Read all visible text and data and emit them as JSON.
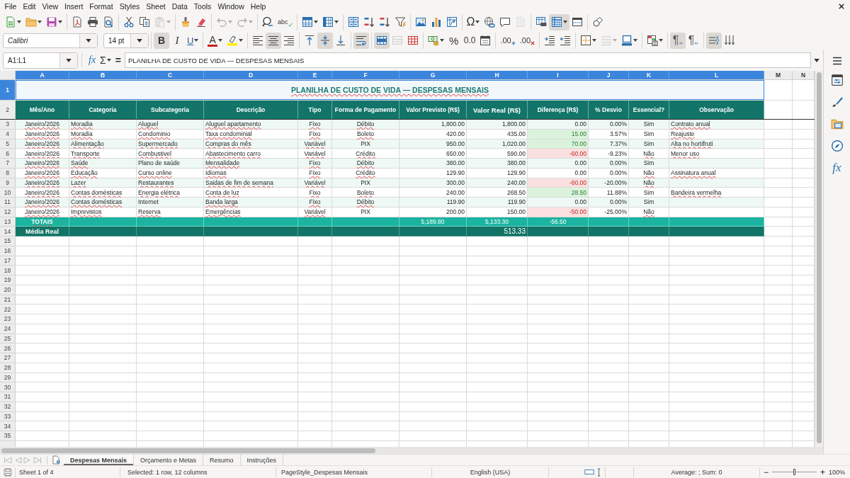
{
  "menu_bar": [
    "File",
    "Edit",
    "View",
    "Insert",
    "Format",
    "Styles",
    "Sheet",
    "Data",
    "Tools",
    "Window",
    "Help"
  ],
  "standard_toolbar": [
    [
      {
        "kind": "new",
        "on": false,
        "disabled": false,
        "dropdown": true
      },
      {
        "kind": "open",
        "on": false,
        "disabled": false,
        "dropdown": true
      },
      {
        "kind": "save",
        "on": false,
        "disabled": false,
        "dropdown": true
      }
    ],
    [
      {
        "kind": "export_pdf",
        "on": false,
        "disabled": false,
        "dropdown": false
      },
      {
        "kind": "print",
        "on": false,
        "disabled": false,
        "dropdown": false
      },
      {
        "kind": "print_preview",
        "on": false,
        "disabled": false,
        "dropdown": false
      }
    ],
    [
      {
        "kind": "cut",
        "on": false,
        "disabled": false,
        "dropdown": false
      },
      {
        "kind": "copy",
        "on": false,
        "disabled": false,
        "dropdown": false
      },
      {
        "kind": "paste",
        "on": false,
        "disabled": true,
        "dropdown": true
      }
    ],
    [
      {
        "kind": "clone_formatting",
        "on": false,
        "disabled": false,
        "dropdown": false
      },
      {
        "kind": "clear_formatting",
        "on": false,
        "disabled": false,
        "dropdown": false
      }
    ],
    [
      {
        "kind": "undo",
        "on": false,
        "disabled": true,
        "dropdown": true
      },
      {
        "kind": "redo",
        "on": false,
        "disabled": true,
        "dropdown": true
      }
    ],
    [
      {
        "kind": "find_replace",
        "on": false,
        "disabled": false,
        "dropdown": false
      },
      {
        "kind": "spelling",
        "label": "abc",
        "on": false,
        "disabled": false,
        "dropdown": false
      }
    ],
    [
      {
        "kind": "rows",
        "on": false,
        "disabled": false,
        "dropdown": true
      },
      {
        "kind": "columns",
        "on": false,
        "disabled": false,
        "dropdown": true
      }
    ],
    [
      {
        "kind": "sort",
        "on": false,
        "disabled": false,
        "dropdown": false
      },
      {
        "kind": "sort_ascending",
        "on": false,
        "disabled": false,
        "dropdown": false
      },
      {
        "kind": "sort_descending",
        "on": false,
        "disabled": false,
        "dropdown": false
      },
      {
        "kind": "autofilter",
        "on": false,
        "disabled": false,
        "dropdown": false
      }
    ],
    [
      {
        "kind": "image",
        "on": false,
        "disabled": false,
        "dropdown": false
      },
      {
        "kind": "chart",
        "on": false,
        "disabled": false,
        "dropdown": false
      },
      {
        "kind": "pivot_table",
        "on": false,
        "disabled": false,
        "dropdown": false
      }
    ],
    [
      {
        "kind": "special_character",
        "label": "Ω",
        "on": false,
        "disabled": false,
        "dropdown": true
      },
      {
        "kind": "hyperlink",
        "on": false,
        "disabled": false,
        "dropdown": false
      },
      {
        "kind": "comment",
        "on": false,
        "disabled": false,
        "dropdown": false
      },
      {
        "kind": "headers_footers",
        "on": false,
        "disabled": true,
        "dropdown": false
      }
    ],
    [
      {
        "kind": "print_area",
        "on": false,
        "disabled": false,
        "dropdown": false
      },
      {
        "kind": "freeze",
        "on": true,
        "disabled": false,
        "dropdown": true
      },
      {
        "kind": "split_window",
        "on": false,
        "disabled": false,
        "dropdown": false
      }
    ],
    [
      {
        "kind": "draw_functions",
        "on": false,
        "disabled": false,
        "dropdown": false
      }
    ]
  ],
  "formatting_toolbar": {
    "font_name": "Calibri",
    "font_size": "14 pt",
    "groups": [
      [
        {
          "kind": "bold",
          "label": "B",
          "on": true,
          "disabled": false,
          "dropdown": false
        },
        {
          "kind": "italic",
          "label": "I",
          "on": false,
          "disabled": false,
          "dropdown": false
        },
        {
          "kind": "underline",
          "label": "U",
          "on": false,
          "disabled": false,
          "dropdown": true
        }
      ],
      [
        {
          "kind": "font_color",
          "label": "A",
          "on": false,
          "disabled": false,
          "dropdown": true
        },
        {
          "kind": "highlight",
          "on": false,
          "disabled": false,
          "dropdown": true
        }
      ],
      [
        {
          "kind": "align_left",
          "on": false,
          "disabled": false,
          "dropdown": false
        },
        {
          "kind": "align_center",
          "on": true,
          "disabled": false,
          "dropdown": false
        },
        {
          "kind": "align_right",
          "on": false,
          "disabled": false,
          "dropdown": false
        }
      ],
      [
        {
          "kind": "align_top",
          "on": false,
          "disabled": false,
          "dropdown": false
        },
        {
          "kind": "align_middle",
          "on": true,
          "disabled": false,
          "dropdown": false
        },
        {
          "kind": "align_bottom",
          "on": false,
          "disabled": false,
          "dropdown": false
        }
      ],
      [
        {
          "kind": "wrap_text",
          "on": true,
          "disabled": false,
          "dropdown": false
        }
      ],
      [
        {
          "kind": "merge_center",
          "on": true,
          "disabled": false,
          "dropdown": false
        },
        {
          "kind": "merge_cells",
          "on": false,
          "disabled": true,
          "dropdown": false
        },
        {
          "kind": "unmerge_cells",
          "on": false,
          "disabled": false,
          "dropdown": false
        }
      ],
      [
        {
          "kind": "currency_format",
          "on": false,
          "disabled": false,
          "dropdown": true
        },
        {
          "kind": "percent_format",
          "label": "%",
          "on": false,
          "disabled": false,
          "dropdown": false
        },
        {
          "kind": "number_format",
          "label": "0.0",
          "on": false,
          "disabled": false,
          "dropdown": false
        },
        {
          "kind": "date_format",
          "on": false,
          "disabled": false,
          "dropdown": false
        }
      ],
      [
        {
          "kind": "add_decimal",
          "label": ".00",
          "on": false,
          "disabled": false,
          "dropdown": false
        },
        {
          "kind": "delete_decimal",
          "label": ".00",
          "on": false,
          "disabled": false,
          "dropdown": false
        }
      ],
      [
        {
          "kind": "indent_increase",
          "on": false,
          "disabled": false,
          "dropdown": false
        },
        {
          "kind": "indent_decrease",
          "on": false,
          "disabled": false,
          "dropdown": false
        }
      ],
      [
        {
          "kind": "borders",
          "on": false,
          "disabled": false,
          "dropdown": true
        },
        {
          "kind": "border_style",
          "on": false,
          "disabled": true,
          "dropdown": true
        },
        {
          "kind": "border_color",
          "on": false,
          "disabled": false,
          "dropdown": true
        }
      ],
      [
        {
          "kind": "conditional_format",
          "on": false,
          "disabled": false,
          "dropdown": true
        }
      ],
      [
        {
          "kind": "paragraph_ltr",
          "label": "¶",
          "on": true,
          "disabled": false,
          "dropdown": false
        },
        {
          "kind": "paragraph_rtl",
          "label": "¶",
          "on": false,
          "disabled": false,
          "dropdown": false
        }
      ],
      [
        {
          "kind": "text_horizontal",
          "on": true,
          "disabled": false,
          "dropdown": false
        },
        {
          "kind": "text_vertical",
          "on": false,
          "disabled": false,
          "dropdown": false
        }
      ]
    ]
  },
  "formula_bar": {
    "name_box": "A1:L1",
    "function_wizard": "fx",
    "sum": "Σ",
    "equals": "=",
    "content": "PLANILHA DE CUSTO DE VIDA — DESPESAS MENSAIS"
  },
  "sheet": {
    "column_headers": [
      {
        "label": "A",
        "selected": true
      },
      {
        "label": "B",
        "selected": true
      },
      {
        "label": "C",
        "selected": true
      },
      {
        "label": "D",
        "selected": true
      },
      {
        "label": "E",
        "selected": true
      },
      {
        "label": "F",
        "selected": true
      },
      {
        "label": "G",
        "selected": true
      },
      {
        "label": "H",
        "selected": true
      },
      {
        "label": "I",
        "selected": true
      },
      {
        "label": "J",
        "selected": true
      },
      {
        "label": "K",
        "selected": true
      },
      {
        "label": "L",
        "selected": true
      },
      {
        "label": "M",
        "selected": false
      },
      {
        "label": "N",
        "selected": false
      }
    ],
    "row_headers": [
      {
        "label": "1",
        "selected": true
      },
      {
        "label": "2",
        "selected": false
      },
      {
        "label": "3",
        "selected": false
      },
      {
        "label": "4",
        "selected": false
      },
      {
        "label": "5",
        "selected": false
      },
      {
        "label": "6",
        "selected": false
      },
      {
        "label": "7",
        "selected": false
      },
      {
        "label": "8",
        "selected": false
      },
      {
        "label": "9",
        "selected": false
      },
      {
        "label": "10",
        "selected": false
      },
      {
        "label": "11",
        "selected": false
      },
      {
        "label": "12",
        "selected": false
      },
      {
        "label": "13",
        "selected": false
      },
      {
        "label": "14",
        "selected": false
      },
      {
        "label": "15",
        "selected": false
      },
      {
        "label": "16",
        "selected": false
      },
      {
        "label": "17",
        "selected": false
      },
      {
        "label": "18",
        "selected": false
      },
      {
        "label": "19",
        "selected": false
      },
      {
        "label": "20",
        "selected": false
      },
      {
        "label": "21",
        "selected": false
      },
      {
        "label": "22",
        "selected": false
      },
      {
        "label": "23",
        "selected": false
      },
      {
        "label": "24",
        "selected": false
      },
      {
        "label": "25",
        "selected": false
      },
      {
        "label": "26",
        "selected": false
      },
      {
        "label": "27",
        "selected": false
      },
      {
        "label": "28",
        "selected": false
      },
      {
        "label": "29",
        "selected": false
      },
      {
        "label": "30",
        "selected": false
      },
      {
        "label": "31",
        "selected": false
      },
      {
        "label": "32",
        "selected": false
      },
      {
        "label": "33",
        "selected": false
      },
      {
        "label": "34",
        "selected": false
      },
      {
        "label": "35",
        "selected": false
      }
    ],
    "title": {
      "text": "PLANILHA DE CUSTO DE VIDA — DESPESAS MENSAIS",
      "misspelled": true,
      "selected": true
    },
    "columns": [
      "Mês/Ano",
      "Categoria",
      "Subcategoria",
      "Descrição",
      "Tipo",
      "Forma de Pagamento",
      "Valor Previsto (R$)",
      "Valor Real (R$)",
      "Diferença (R$)",
      "% Desvio",
      "Essencial?",
      "Observação"
    ],
    "rows": [
      {
        "over_plan": false,
        "under_plan": false,
        "cells": [
          {
            "text": "Janeiro/2026",
            "misspelled": true
          },
          {
            "text": "Moradia",
            "misspelled": true
          },
          {
            "text": "Aluguel",
            "misspelled": true
          },
          {
            "text": "Aluguel apartamento",
            "misspelled": true
          },
          {
            "text": "Fixo",
            "misspelled": true
          },
          {
            "text": "Débito",
            "misspelled": true
          },
          {
            "text": "1,800.00",
            "misspelled": false
          },
          {
            "text": "1,800.00",
            "misspelled": false
          },
          {
            "text": "0.00",
            "misspelled": false
          },
          {
            "text": "0.00%",
            "misspelled": false
          },
          {
            "text": "Sim",
            "misspelled": false
          },
          {
            "text": "Contrato anual",
            "misspelled": true
          }
        ]
      },
      {
        "over_plan": true,
        "under_plan": false,
        "cells": [
          {
            "text": "Janeiro/2026",
            "misspelled": true
          },
          {
            "text": "Moradia",
            "misspelled": true
          },
          {
            "text": "Condominio",
            "misspelled": true
          },
          {
            "text": "Taxa condominial",
            "misspelled": true
          },
          {
            "text": "Fixo",
            "misspelled": true
          },
          {
            "text": "Boleto",
            "misspelled": true
          },
          {
            "text": "420.00",
            "misspelled": false
          },
          {
            "text": "435.00",
            "misspelled": false
          },
          {
            "text": "15.00",
            "misspelled": false
          },
          {
            "text": "3.57%",
            "misspelled": false
          },
          {
            "text": "Sim",
            "misspelled": false
          },
          {
            "text": "Reajuste",
            "misspelled": true
          }
        ]
      },
      {
        "over_plan": true,
        "under_plan": false,
        "cells": [
          {
            "text": "Janeiro/2026",
            "misspelled": true
          },
          {
            "text": "Alimentação",
            "misspelled": true
          },
          {
            "text": "Supermercado",
            "misspelled": true
          },
          {
            "text": "Compras do mês",
            "misspelled": true
          },
          {
            "text": "Variável",
            "misspelled": true
          },
          {
            "text": "PIX",
            "misspelled": false
          },
          {
            "text": "950.00",
            "misspelled": false
          },
          {
            "text": "1,020.00",
            "misspelled": false
          },
          {
            "text": "70.00",
            "misspelled": false
          },
          {
            "text": "7.37%",
            "misspelled": false
          },
          {
            "text": "Sim",
            "misspelled": false
          },
          {
            "text": "Alta no hortifruti",
            "misspelled": true
          }
        ]
      },
      {
        "over_plan": false,
        "under_plan": true,
        "cells": [
          {
            "text": "Janeiro/2026",
            "misspelled": true
          },
          {
            "text": "Transporte",
            "misspelled": true
          },
          {
            "text": "Combustivel",
            "misspelled": true
          },
          {
            "text": "Abastecimento carro",
            "misspelled": true
          },
          {
            "text": "Variável",
            "misspelled": true
          },
          {
            "text": "Crédito",
            "misspelled": true
          },
          {
            "text": "650.00",
            "misspelled": false
          },
          {
            "text": "590.00",
            "misspelled": false
          },
          {
            "text": "-60.00",
            "misspelled": false
          },
          {
            "text": "-9.23%",
            "misspelled": false
          },
          {
            "text": "Não",
            "misspelled": true
          },
          {
            "text": "Menor uso",
            "misspelled": true
          }
        ]
      },
      {
        "over_plan": false,
        "under_plan": false,
        "cells": [
          {
            "text": "Janeiro/2026",
            "misspelled": true
          },
          {
            "text": "Saúde",
            "misspelled": true
          },
          {
            "text": "Plano de saúde",
            "misspelled": false
          },
          {
            "text": "Mensalidade",
            "misspelled": true
          },
          {
            "text": "Fixo",
            "misspelled": true
          },
          {
            "text": "Débito",
            "misspelled": true
          },
          {
            "text": "380.00",
            "misspelled": false
          },
          {
            "text": "380.00",
            "misspelled": false
          },
          {
            "text": "0.00",
            "misspelled": false
          },
          {
            "text": "0.00%",
            "misspelled": false
          },
          {
            "text": "Sim",
            "misspelled": false
          }
        ]
      },
      {
        "over_plan": false,
        "under_plan": false,
        "cells": [
          {
            "text": "Janeiro/2026",
            "misspelled": true
          },
          {
            "text": "Educação",
            "misspelled": true
          },
          {
            "text": "Curso online",
            "misspelled": true
          },
          {
            "text": "Idiomas",
            "misspelled": true
          },
          {
            "text": "Fixo",
            "misspelled": true
          },
          {
            "text": "Crédito",
            "misspelled": true
          },
          {
            "text": "129.90",
            "misspelled": false
          },
          {
            "text": "129.90",
            "misspelled": false
          },
          {
            "text": "0.00",
            "misspelled": false
          },
          {
            "text": "0.00%",
            "misspelled": false
          },
          {
            "text": "Não",
            "misspelled": true
          },
          {
            "text": "Assinatura anual",
            "misspelled": true
          }
        ]
      },
      {
        "over_plan": false,
        "under_plan": true,
        "cells": [
          {
            "text": "Janeiro/2026",
            "misspelled": true
          },
          {
            "text": "Lazer",
            "misspelled": true
          },
          {
            "text": "Restaurantes",
            "misspelled": true
          },
          {
            "text": "Saidas de fim de semana",
            "misspelled": true
          },
          {
            "text": "Variável",
            "misspelled": true
          },
          {
            "text": "PIX",
            "misspelled": false
          },
          {
            "text": "300.00",
            "misspelled": false
          },
          {
            "text": "240.00",
            "misspelled": false
          },
          {
            "text": "-60.00",
            "misspelled": false
          },
          {
            "text": "-20.00%",
            "misspelled": false
          },
          {
            "text": "Não",
            "misspelled": true
          }
        ]
      },
      {
        "over_plan": true,
        "under_plan": false,
        "cells": [
          {
            "text": "Janeiro/2026",
            "misspelled": true
          },
          {
            "text": "Contas domésticas",
            "misspelled": true
          },
          {
            "text": "Energia elétrica",
            "misspelled": true
          },
          {
            "text": "Conta de luz",
            "misspelled": true
          },
          {
            "text": "Fixo",
            "misspelled": true
          },
          {
            "text": "Boleto",
            "misspelled": true
          },
          {
            "text": "240.00",
            "misspelled": false
          },
          {
            "text": "268.50",
            "misspelled": false
          },
          {
            "text": "28.50",
            "misspelled": false
          },
          {
            "text": "11.88%",
            "misspelled": false
          },
          {
            "text": "Sim",
            "misspelled": false
          },
          {
            "text": "Bandeira vermelha",
            "misspelled": true
          }
        ]
      },
      {
        "over_plan": false,
        "under_plan": false,
        "cells": [
          {
            "text": "Janeiro/2026",
            "misspelled": true
          },
          {
            "text": "Contas domésticas",
            "misspelled": true
          },
          {
            "text": "Internet",
            "misspelled": false
          },
          {
            "text": "Banda larga",
            "misspelled": true
          },
          {
            "text": "Fixo",
            "misspelled": true
          },
          {
            "text": "Débito",
            "misspelled": true
          },
          {
            "text": "119.90",
            "misspelled": false
          },
          {
            "text": "119.90",
            "misspelled": false
          },
          {
            "text": "0.00",
            "misspelled": false
          },
          {
            "text": "0.00%",
            "misspelled": false
          },
          {
            "text": "Sim",
            "misspelled": false
          }
        ]
      },
      {
        "over_plan": false,
        "under_plan": true,
        "cells": [
          {
            "text": "Janeiro/2026",
            "misspelled": true
          },
          {
            "text": "Imprevistos",
            "misspelled": true
          },
          {
            "text": "Reserva",
            "misspelled": true
          },
          {
            "text": "Emergências",
            "misspelled": true
          },
          {
            "text": "Variável",
            "misspelled": true
          },
          {
            "text": "PIX",
            "misspelled": false
          },
          {
            "text": "200.00",
            "misspelled": false
          },
          {
            "text": "150.00",
            "misspelled": false
          },
          {
            "text": "-50.00",
            "misspelled": false
          },
          {
            "text": "-25.00%",
            "misspelled": false
          },
          {
            "text": "Não",
            "misspelled": true
          }
        ]
      }
    ],
    "totals": {
      "label": {
        "text": "TOTAIS",
        "misspelled": true
      },
      "planned": "5,189.80",
      "actual": "5,133.30",
      "difference": "-56.50"
    },
    "average": {
      "label": {
        "text": "Média Real",
        "misspelled": false
      },
      "actual": "513.33"
    }
  },
  "sheet_tabs": [
    {
      "label": "Despesas Mensais",
      "selected": true
    },
    {
      "label": "Orçamento e Metas",
      "selected": false
    },
    {
      "label": "Resumo",
      "selected": false
    },
    {
      "label": "Instruções",
      "selected": false
    }
  ],
  "sidebar": [
    {
      "kind": "properties"
    },
    {
      "kind": "styles"
    },
    {
      "kind": "gallery"
    },
    {
      "kind": "navigator"
    },
    {
      "kind": "functions",
      "label": "fx"
    }
  ],
  "status_bar": {
    "sheet": "Sheet 1 of 4",
    "selection": "Selected: 1 row, 12 columns",
    "page_style": "PageStyle_Despesas Mensais",
    "language": "English (USA)",
    "summary": "Average: ; Sum: 0",
    "zoom_out": "−",
    "zoom_in": "+",
    "zoom_slider": {
      "level": 0.5
    },
    "zoom": "100%"
  }
}
